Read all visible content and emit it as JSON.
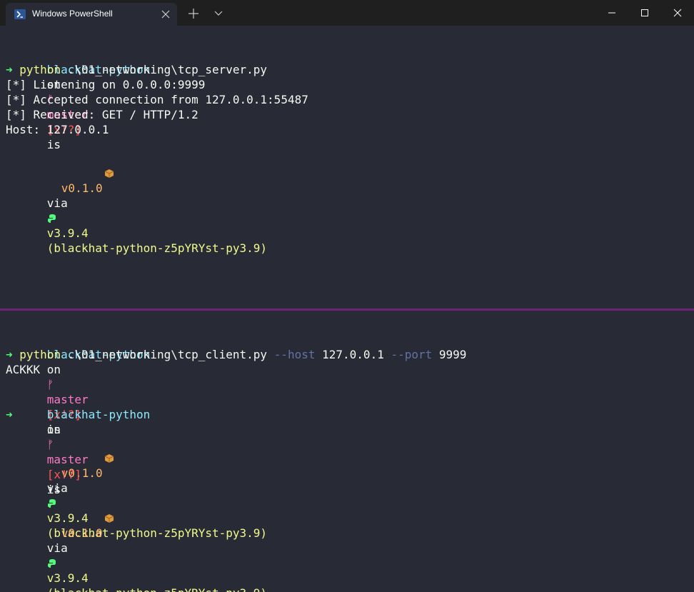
{
  "window": {
    "tab_title": "Windows PowerShell",
    "icons": {
      "tab": "powershell-icon",
      "close": "close-icon",
      "new_tab": "plus-icon",
      "dropdown": "chevron-down-icon",
      "minimize": "minimize-icon",
      "maximize": "maximize-icon",
      "window_close": "close-icon"
    }
  },
  "prompt": {
    "dir": "blackhat-python",
    "on": "on",
    "branch_icon": "ᚠ",
    "branch": "master",
    "status": "[x!?]",
    "is": "is",
    "package_icon": "package-icon",
    "version": "v0.1.0",
    "via": "via",
    "python_icon": "python-icon",
    "python_version": "v3.9.4",
    "venv": "(blackhat-python-z5pYRYst-py3.9)",
    "arrow": "➜"
  },
  "top_pane": {
    "command": "python",
    "command_args": " .\\01_networking\\tcp_server.py",
    "output": [
      "[*] Listening on 0.0.0.0:9999",
      "[*] Accepted connection from 127.0.0.1:55487",
      "[*] Received: GET / HTTP/1.2",
      "Host: 127.0.0.1"
    ]
  },
  "bottom_pane": {
    "command": "python",
    "command_args": " .\\01_networking\\tcp_client.py ",
    "flag_host": "--host",
    "host_value": " 127.0.0.1 ",
    "flag_port": "--port",
    "port_value": " 9999",
    "output": [
      "ACKKK"
    ]
  },
  "colors": {
    "background": "#282a36",
    "titlebar": "#1f1f1f",
    "divider": "#6c2576",
    "dir": "#8be9fd",
    "branch": "#ff79c6",
    "status": "#ff5555",
    "version": "#ffb86c",
    "python_version": "#f1fa8c",
    "arrow": "#50fa7b"
  }
}
